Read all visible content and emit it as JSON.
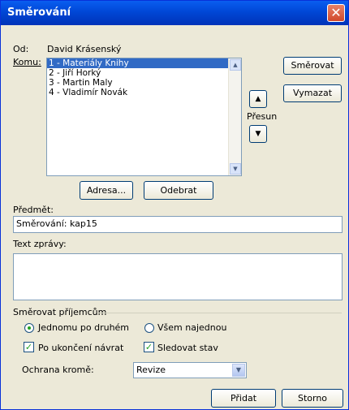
{
  "window": {
    "title": "Směrování",
    "close_glyph": "✕"
  },
  "from": {
    "label": "Od:",
    "value": "David Krásenský"
  },
  "to": {
    "label": "Komu:",
    "items": [
      "1 - Materiály Knihy",
      "2 - Jiří Horký",
      "3 - Martin Maly",
      "4 - Vladimír Novák"
    ],
    "selected_index": 0
  },
  "buttons": {
    "route": "Směrovat",
    "clear": "Vymazat",
    "address": "Adresa...",
    "remove": "Odebrat",
    "add": "Přidat",
    "cancel": "Storno"
  },
  "move": {
    "label": "Přesun",
    "up_glyph": "▲",
    "down_glyph": "▼"
  },
  "subject": {
    "label": "Předmět:",
    "value": "Směrování: kap15"
  },
  "message": {
    "label": "Text zprávy:",
    "value": ""
  },
  "routing": {
    "group_label": "Směrovat příjemcům",
    "one_after_another": {
      "label": "Jednomu po druhém",
      "checked": true
    },
    "all_at_once": {
      "label": "Všem najednou",
      "checked": false
    },
    "return_when_done": {
      "label": "Po ukončení návrat",
      "checked": true
    },
    "track_status": {
      "label": "Sledovat stav",
      "checked": true
    },
    "protect": {
      "label": "Ochrana kromě:",
      "value": "Revize"
    }
  }
}
